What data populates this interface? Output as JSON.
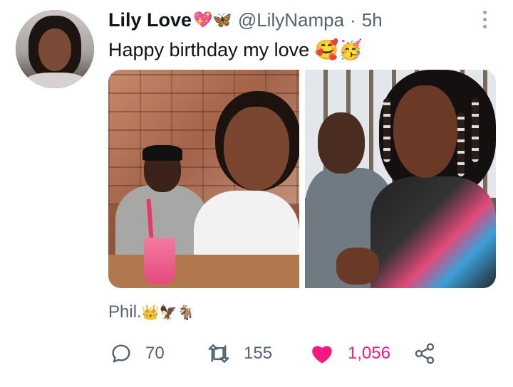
{
  "tweet": {
    "display_name": "Lily Love",
    "name_emojis": "💖🦋",
    "handle": "@LilyNampa",
    "separator": "·",
    "time": "5h",
    "text": "Happy birthday my love 🥰🥳",
    "caption": "Phil.",
    "caption_emojis": "👑🦅🐐",
    "icons": {
      "more": "more-options-icon",
      "reply": "reply-icon",
      "retweet": "retweet-icon",
      "like": "heart-icon",
      "share": "share-icon"
    },
    "actions": {
      "reply_count": "70",
      "retweet_count": "155",
      "like_count": "1,056"
    },
    "colors": {
      "text": "#0f1419",
      "secondary": "#536471",
      "like": "#f91880",
      "more_dots": "#9aa3ab"
    }
  }
}
